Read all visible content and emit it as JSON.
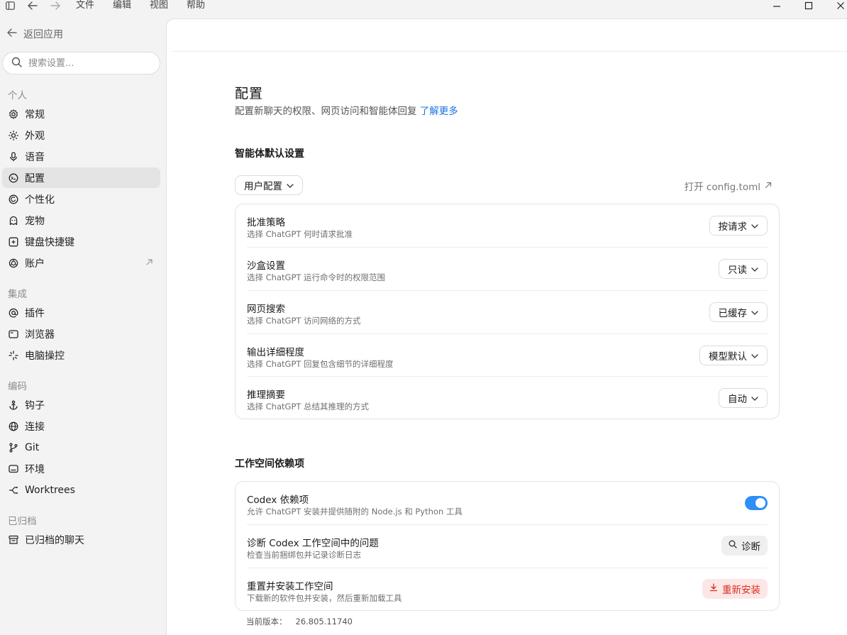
{
  "menubar": {
    "items": [
      "文件",
      "编辑",
      "视图",
      "帮助"
    ]
  },
  "sidebar": {
    "back_label": "返回应用",
    "search_placeholder": "搜索设置...",
    "sections": [
      {
        "title": "个人",
        "items": [
          {
            "label": "常规",
            "icon": "gear-icon"
          },
          {
            "label": "外观",
            "icon": "sun-icon"
          },
          {
            "label": "语音",
            "icon": "microphone-icon"
          },
          {
            "label": "配置",
            "icon": "config-icon",
            "active": true
          },
          {
            "label": "个性化",
            "icon": "smile-icon"
          },
          {
            "label": "宠物",
            "icon": "pet-icon"
          },
          {
            "label": "键盘快捷键",
            "icon": "keyboard-icon"
          },
          {
            "label": "账户",
            "icon": "openai-icon",
            "external": true
          }
        ]
      },
      {
        "title": "集成",
        "items": [
          {
            "label": "插件",
            "icon": "at-icon"
          },
          {
            "label": "浏览器",
            "icon": "browser-icon"
          },
          {
            "label": "电脑操控",
            "icon": "sparkle-icon"
          }
        ]
      },
      {
        "title": "编码",
        "items": [
          {
            "label": "钩子",
            "icon": "anchor-icon"
          },
          {
            "label": "连接",
            "icon": "globe-icon"
          },
          {
            "label": "Git",
            "icon": "git-branch-icon"
          },
          {
            "label": "环境",
            "icon": "terminal-icon"
          },
          {
            "label": "Worktrees",
            "icon": "worktree-icon"
          }
        ]
      },
      {
        "title": "已归档",
        "items": [
          {
            "label": "已归档的聊天",
            "icon": "archive-icon"
          }
        ]
      }
    ]
  },
  "main": {
    "title": "配置",
    "description": "配置新聊天的权限、网页访问和智能体回复",
    "learn_more": "了解更多",
    "agent_section": {
      "title": "智能体默认设置",
      "profile_label": "用户配置",
      "open_config_label": "打开 config.toml",
      "rows": [
        {
          "title": "批准策略",
          "desc": "选择 ChatGPT 何时请求批准",
          "value": "按请求"
        },
        {
          "title": "沙盒设置",
          "desc": "选择 ChatGPT 运行命令时的权限范围",
          "value": "只读"
        },
        {
          "title": "网页搜索",
          "desc": "选择 ChatGPT 访问网络的方式",
          "value": "已缓存"
        },
        {
          "title": "输出详细程度",
          "desc": "选择 ChatGPT 回复包含细节的详细程度",
          "value": "模型默认"
        },
        {
          "title": "推理摘要",
          "desc": "选择 ChatGPT 总结其推理的方式",
          "value": "自动"
        }
      ]
    },
    "workspace_section": {
      "title": "工作空间依赖项",
      "rows": [
        {
          "title": "Codex 依赖项",
          "desc": "允许 ChatGPT 安装并提供随附的 Node.js 和 Python 工具",
          "toggle": true
        },
        {
          "title": "诊断 Codex 工作空间中的问题",
          "desc": "检查当前捆绑包并记录诊断日志",
          "button": "诊断"
        },
        {
          "title": "重置并安装工作空间",
          "desc": "下载新的软件包并安装，然后重新加载工具",
          "button": "重新安装"
        }
      ],
      "version_label": "当前版本：",
      "version_value": "26.805.11740"
    }
  },
  "colors": {
    "accent": "#2f8ff5",
    "link": "#1a73e8",
    "danger": "#d93025",
    "danger_bg": "#fde7e6",
    "sidebar_bg": "#f3f3f3",
    "active_item_bg": "#e4e4e4"
  }
}
